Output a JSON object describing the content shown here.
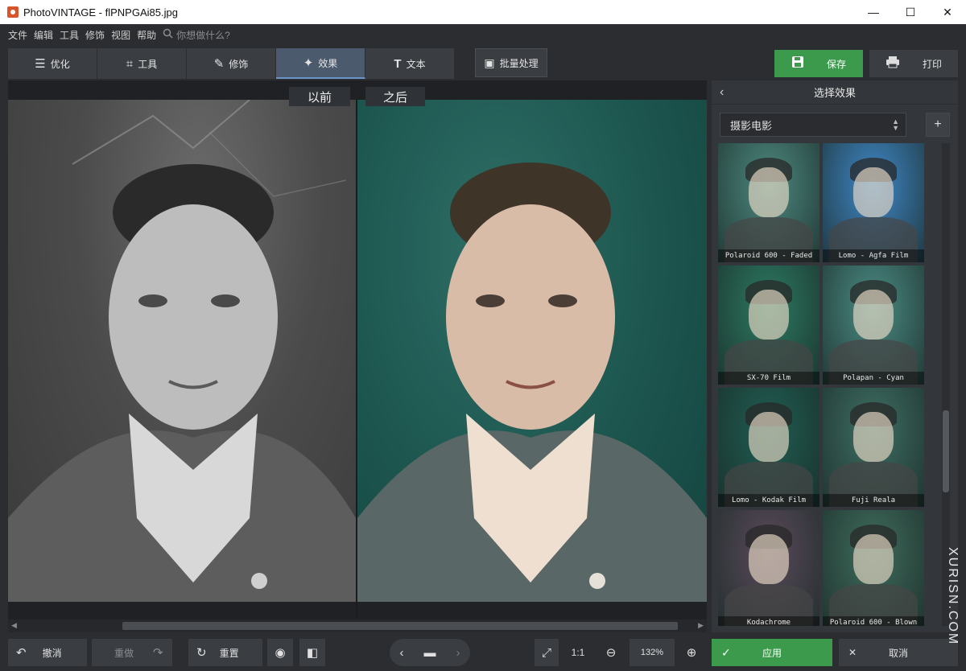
{
  "window": {
    "title": "PhotoVINTAGE - flPNPGAi85.jpg",
    "minimize": "—",
    "maximize": "☐",
    "close": "✕"
  },
  "menu": {
    "items": [
      "文件",
      "编辑",
      "工具",
      "修饰",
      "视图",
      "帮助"
    ],
    "search_placeholder": "你想做什么?"
  },
  "toolbar": {
    "tabs": [
      {
        "label": "优化",
        "icon": "sliders-icon"
      },
      {
        "label": "工具",
        "icon": "crop-icon"
      },
      {
        "label": "修饰",
        "icon": "brush-icon"
      },
      {
        "label": "效果",
        "icon": "wand-icon",
        "active": true
      },
      {
        "label": "文本",
        "icon": "text-icon"
      }
    ],
    "batch": "批量处理",
    "save": "保存",
    "print": "打印"
  },
  "canvas": {
    "before_label": "以前",
    "after_label": "之后"
  },
  "panel": {
    "title": "选择效果",
    "preset": "摄影电影",
    "add": "+",
    "effects": [
      {
        "name": "Polaroid 600 - Faded",
        "tint": "#4d8a80"
      },
      {
        "name": "Lomo - Agfa Film",
        "tint": "#3f88c8"
      },
      {
        "name": "SX-70 Film",
        "tint": "#2c7a62"
      },
      {
        "name": "Polapan - Cyan",
        "tint": "#4b8c84"
      },
      {
        "name": "Lomo - Kodak Film",
        "tint": "#1f5e52"
      },
      {
        "name": "Fuji Reala",
        "tint": "#3e6f63"
      },
      {
        "name": "Kodachrome",
        "tint": "#5a4a5a"
      },
      {
        "name": "Polaroid 600 - Blown",
        "tint": "#3f6c5c"
      }
    ]
  },
  "bottom": {
    "undo": "撤消",
    "redo": "重做",
    "reset": "重置",
    "ratio": "1:1",
    "zoom": "132%",
    "apply": "应用",
    "cancel": "取消"
  },
  "watermark": "XURISN.COM",
  "colors": {
    "accent_green": "#3b9a4b",
    "active_tab": "#4c5a6e",
    "background": "#2b2d30"
  }
}
